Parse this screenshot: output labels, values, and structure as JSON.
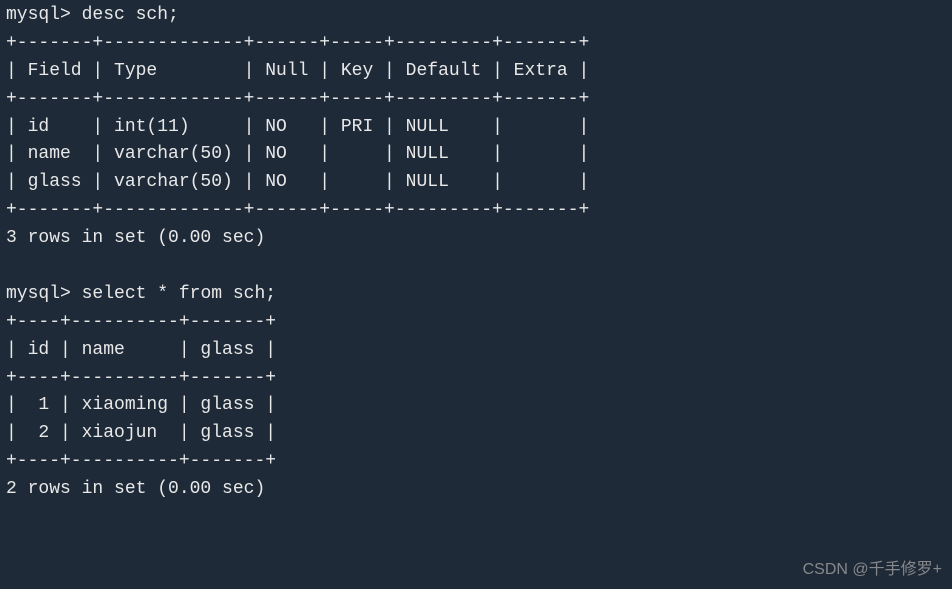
{
  "commands": {
    "prompt": "mysql>",
    "cmd1": "desc sch;",
    "cmd2": "select * from sch;"
  },
  "desc_table": {
    "columns": [
      "Field",
      "Type",
      "Null",
      "Key",
      "Default",
      "Extra"
    ],
    "rows": [
      {
        "field": "id",
        "type": "int(11)",
        "null": "NO",
        "key": "PRI",
        "default": "NULL",
        "extra": ""
      },
      {
        "field": "name",
        "type": "varchar(50)",
        "null": "NO",
        "key": "",
        "default": "NULL",
        "extra": ""
      },
      {
        "field": "glass",
        "type": "varchar(50)",
        "null": "NO",
        "key": "",
        "default": "NULL",
        "extra": ""
      }
    ],
    "footer": "3 rows in set (0.00 sec)"
  },
  "select_table": {
    "columns": [
      "id",
      "name",
      "glass"
    ],
    "rows": [
      {
        "id": "1",
        "name": "xiaoming",
        "glass": "glass"
      },
      {
        "id": "2",
        "name": "xiaojun",
        "glass": "glass"
      }
    ],
    "footer": "2 rows in set (0.00 sec)"
  },
  "watermark": "CSDN @千手修罗+"
}
